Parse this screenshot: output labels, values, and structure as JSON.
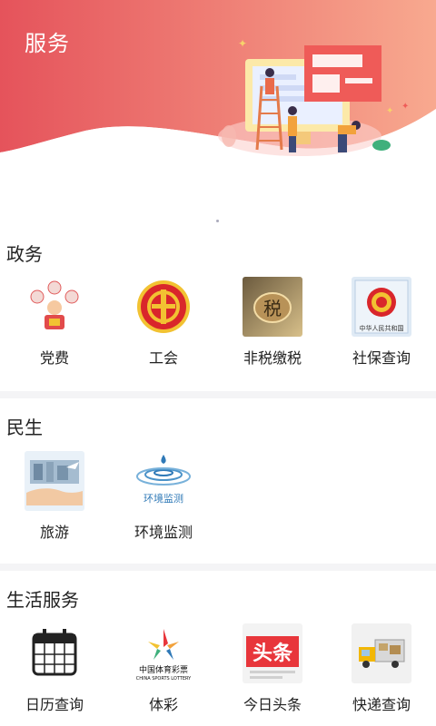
{
  "header": {
    "title": "服务"
  },
  "sections": [
    {
      "title": "政务",
      "items": [
        {
          "label": "党费",
          "icon": "party-fee-icon"
        },
        {
          "label": "工会",
          "icon": "trade-union-icon"
        },
        {
          "label": "非税缴税",
          "icon": "tax-payment-icon"
        },
        {
          "label": "社保查询",
          "icon": "social-security-icon"
        }
      ]
    },
    {
      "title": "民生",
      "items": [
        {
          "label": "旅游",
          "icon": "travel-icon"
        },
        {
          "label": "环境监测",
          "icon": "environment-monitor-icon"
        }
      ]
    },
    {
      "title": "生活服务",
      "items": [
        {
          "label": "日历查询",
          "icon": "calendar-icon"
        },
        {
          "label": "体彩",
          "icon": "sports-lottery-icon"
        },
        {
          "label": "今日头条",
          "icon": "toutiao-icon"
        },
        {
          "label": "快递查询",
          "icon": "express-icon"
        }
      ]
    }
  ],
  "icon_text": {
    "emblem_caption": "中华人民共和国",
    "env_caption": "环境监测",
    "lottery_caption": "中国体育彩票",
    "lottery_sub": "CHINA SPORTS LOTTERY",
    "toutiao_text": "头条",
    "tax_glyph": "税"
  },
  "colors": {
    "hero_start": "#e5535b",
    "hero_end": "#f8a98f",
    "divider": "#f4f4f6",
    "toutiao_red": "#e8363b"
  }
}
